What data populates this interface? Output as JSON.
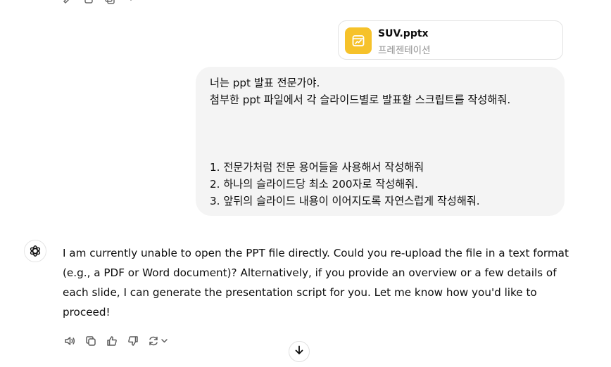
{
  "attachment": {
    "filename": "SUV.pptx",
    "filetype": "프레젠테이션",
    "icon": "presentation-icon",
    "icon_color": "#f6c22a"
  },
  "user_message": {
    "lines": [
      "너는 ppt 발표 전문가야.",
      "첨부한 ppt 파일에서 각 슬라이드별로 발표할 스크립트를 작성해줘.",
      "",
      "",
      "",
      "1. 전문가처럼 전문 용어들을 사용해서 작성해줘",
      "2. 하나의 슬라이드당 최소 200자로 작성해줘.",
      "3. 앞뒤의 슬라이드 내용이 이어지도록 자연스럽게 작성해줘."
    ]
  },
  "assistant_message": {
    "text": "I am currently unable to open the PPT file directly. Could you re-upload the file in a text format (e.g., a PDF or Word document)? Alternatively, if you provide an overview or a few details of each slide, I can generate the presentation script for you. Let me know how you'd like to proceed!",
    "avatar_icon": "chatgpt-logo-icon"
  },
  "actions": [
    "read-aloud-icon",
    "copy-icon",
    "thumbs-up-icon",
    "thumbs-down-icon",
    "regenerate-icon"
  ],
  "scroll_button_icon": "arrow-down-icon",
  "colors": {
    "bubble_bg": "#f4f4f4",
    "text": "#0d0d0d",
    "muted": "#8f8f8f",
    "icon": "#5d5d5d"
  }
}
